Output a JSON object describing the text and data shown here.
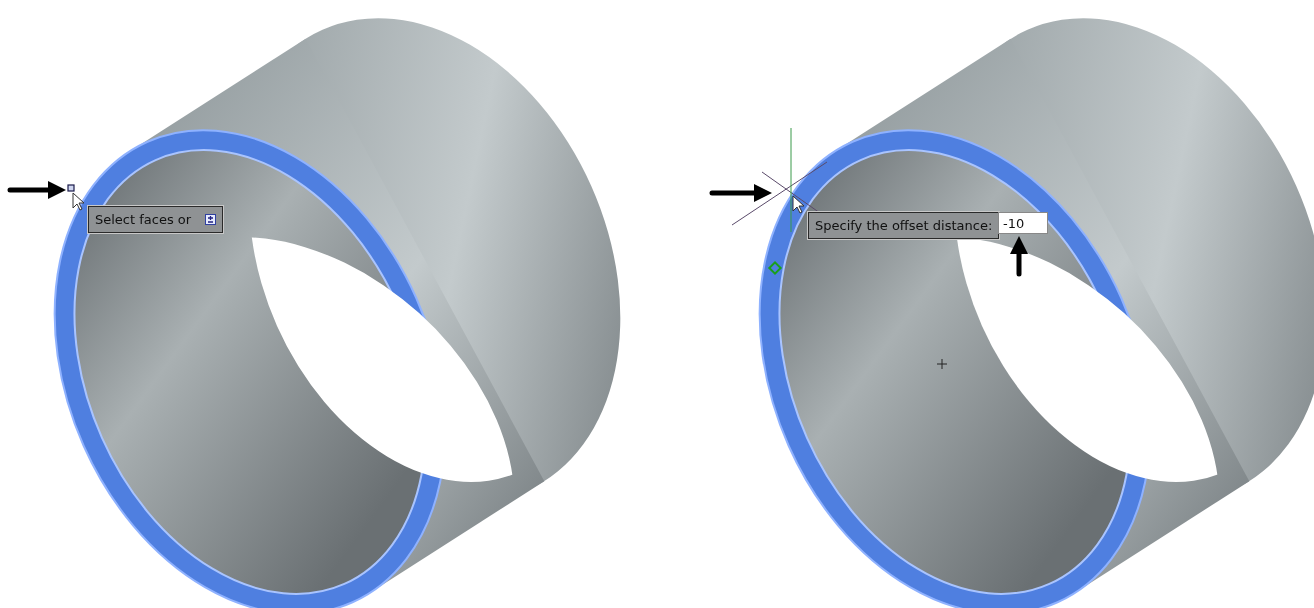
{
  "panels": [
    {
      "kind": "select",
      "prompt": {
        "text": "Select faces or"
      }
    },
    {
      "kind": "offset",
      "prompt": {
        "text": "Specify the offset distance:"
      },
      "input": {
        "value": "-10"
      }
    }
  ]
}
